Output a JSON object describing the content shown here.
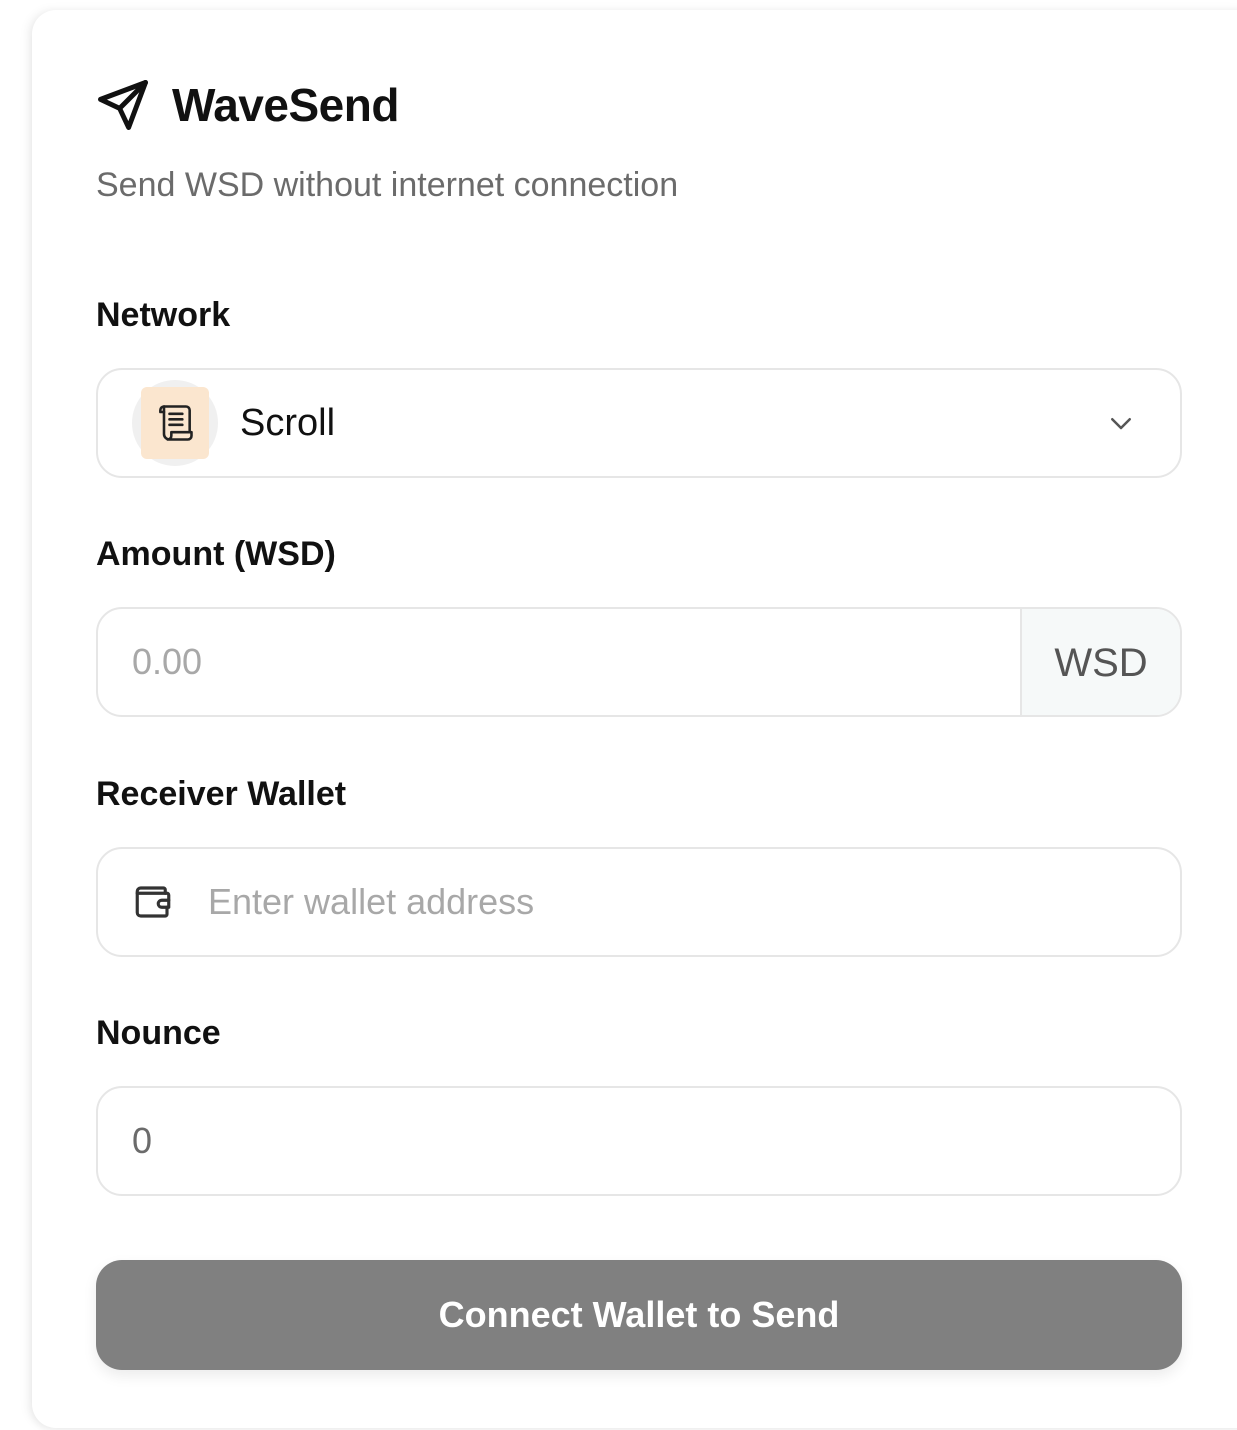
{
  "app": {
    "title": "WaveSend",
    "subtitle": "Send WSD without internet connection",
    "logo_icon": "paper-plane-icon"
  },
  "form": {
    "network": {
      "label": "Network",
      "selected": "Scroll",
      "selected_icon": "scroll-icon",
      "dropdown_icon": "chevron-down-icon"
    },
    "amount": {
      "label": "Amount (WSD)",
      "value": "",
      "placeholder": "0.00",
      "unit": "WSD"
    },
    "receiver": {
      "label": "Receiver Wallet",
      "value": "",
      "placeholder": "Enter wallet address",
      "icon": "wallet-icon"
    },
    "nonce": {
      "label": "Nounce",
      "value": "0"
    },
    "submit_label": "Connect Wallet to Send"
  },
  "colors": {
    "button_disabled": "#808080",
    "network_badge": "#fbe6cf",
    "border": "#e6e6e6"
  }
}
